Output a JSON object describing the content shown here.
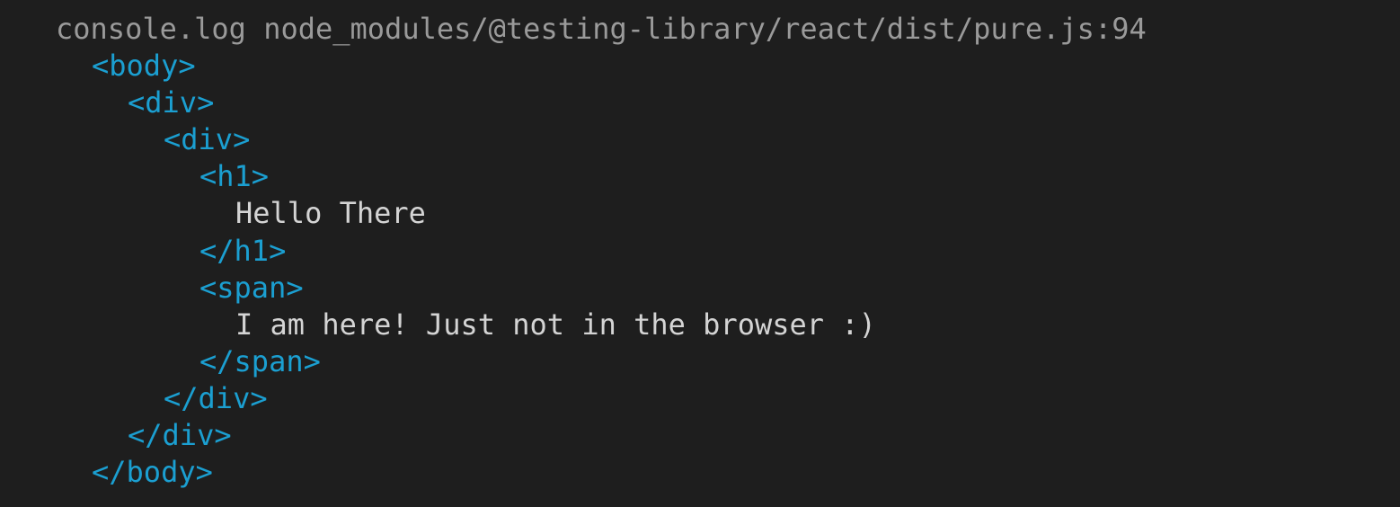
{
  "console": {
    "header": "console.log node_modules/@testing-library/react/dist/pure.js:94",
    "lines": [
      {
        "text": "<body>",
        "kind": "tag",
        "indent": 1
      },
      {
        "text": "<div>",
        "kind": "tag",
        "indent": 2
      },
      {
        "text": "<div>",
        "kind": "tag",
        "indent": 3
      },
      {
        "text": "<h1>",
        "kind": "tag",
        "indent": 4
      },
      {
        "text": "Hello There",
        "kind": "text",
        "indent": 5
      },
      {
        "text": "</h1>",
        "kind": "tag",
        "indent": 4
      },
      {
        "text": "<span>",
        "kind": "tag",
        "indent": 4
      },
      {
        "text": "I am here! Just not in the browser :)",
        "kind": "text",
        "indent": 5
      },
      {
        "text": "</span>",
        "kind": "tag",
        "indent": 4
      },
      {
        "text": "</div>",
        "kind": "tag",
        "indent": 3
      },
      {
        "text": "</div>",
        "kind": "tag",
        "indent": 2
      },
      {
        "text": "</body>",
        "kind": "tag",
        "indent": 1
      }
    ]
  },
  "colors": {
    "background": "#1e1e1e",
    "header": "#9a9a9a",
    "tag": "#1b9fd1",
    "text": "#d4d4d4"
  }
}
